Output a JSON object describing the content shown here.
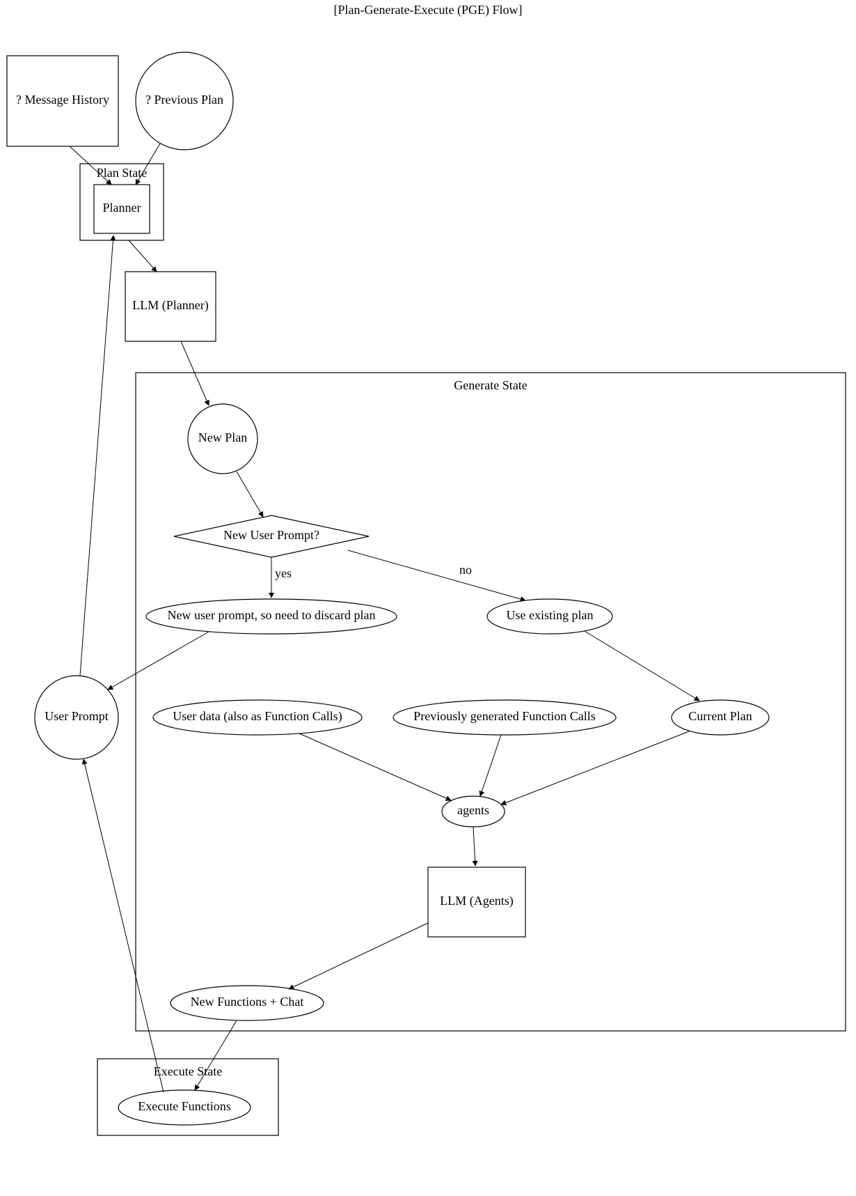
{
  "title": "[Plan-Generate-Execute (PGE) Flow]",
  "nodes": {
    "msg_history": "? Message History",
    "prev_plan": "? Previous Plan",
    "plan_state": "Plan State",
    "planner": "Planner",
    "llm_planner": "LLM (Planner)",
    "generate_state": "Generate State",
    "new_plan": "New Plan",
    "decision": "New User Prompt?",
    "discard_plan": "New user prompt, so need to discard plan",
    "use_existing": "Use existing plan",
    "user_prompt": "User Prompt",
    "user_data": "User data (also as Function Calls)",
    "prev_fc": "Previously generated Function Calls",
    "current_plan": "Current Plan",
    "agents": "agents",
    "llm_agents": "LLM (Agents)",
    "new_functions": "New Functions + Chat",
    "execute_state": "Execute State",
    "execute_fn": "Execute Functions"
  },
  "edges": {
    "yes": "yes",
    "no": "no"
  }
}
